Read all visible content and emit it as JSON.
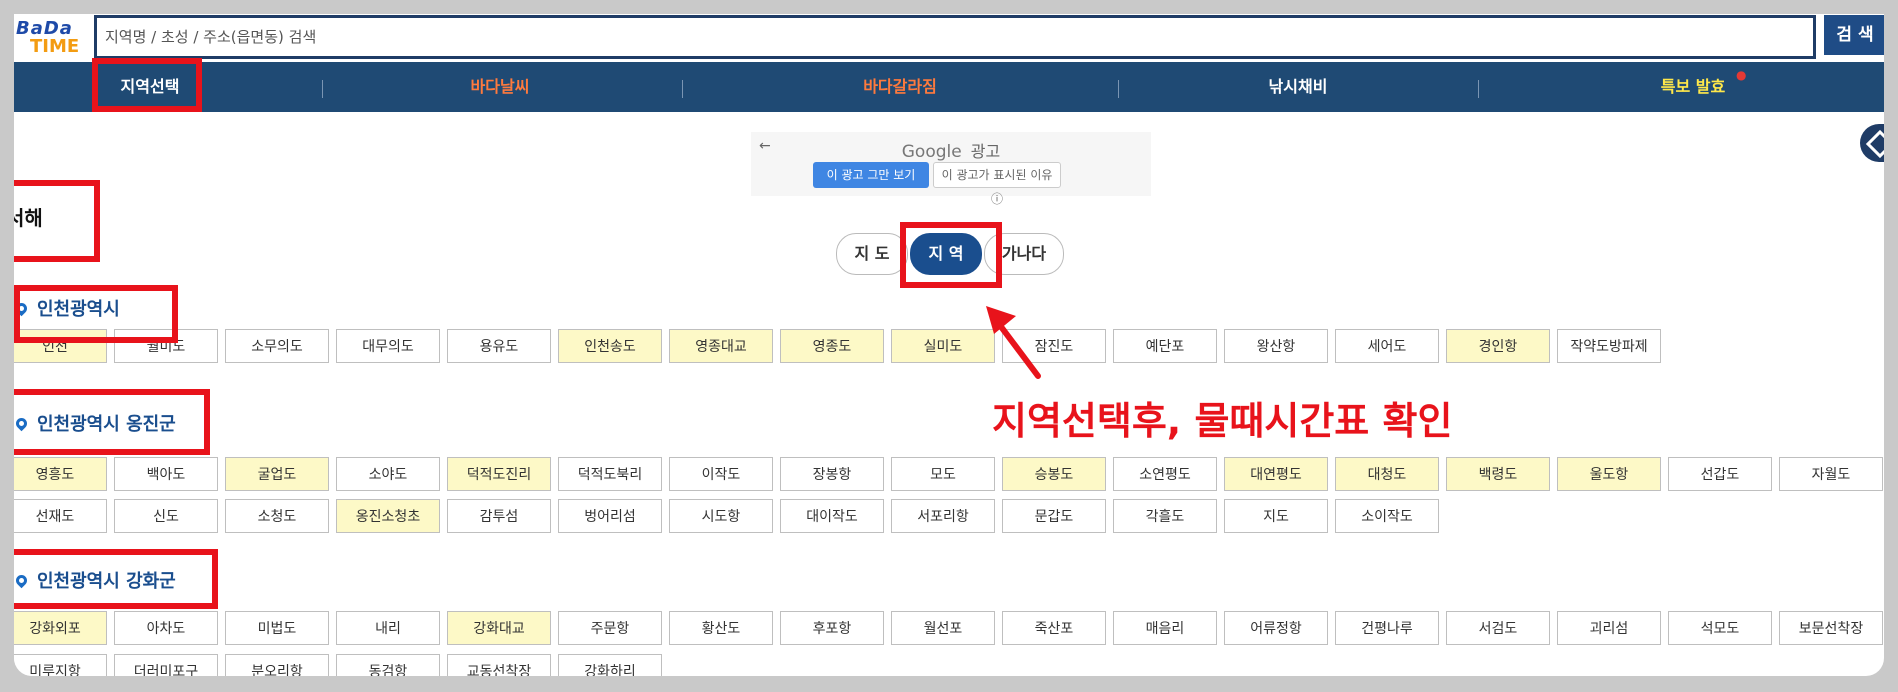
{
  "logo": {
    "line1": "BaDa",
    "line2": "TIME"
  },
  "search": {
    "placeholder": "지역명 / 초성 / 주소(읍면동) 검색",
    "button_label": "검 색"
  },
  "nav": {
    "items": [
      {
        "label": "지역선택",
        "color": "#ffffff"
      },
      {
        "label": "바다날씨",
        "color": "#ff7a3d"
      },
      {
        "label": "바다갈라짐",
        "color": "#ff7a3d"
      },
      {
        "label": "낚시채비",
        "color": "#ffffff"
      },
      {
        "label": "특보 발효",
        "color": "#ffe84a"
      }
    ]
  },
  "ad": {
    "brand": "Google",
    "label": "광고",
    "stop_button": "이 광고 그만 보기",
    "why_button": "이 광고가 표시된 이유 ⓘ"
  },
  "region_title": "서해",
  "view_tabs": {
    "map": "지 도",
    "region": "지 역",
    "gana": "가나다"
  },
  "annotation_text": "지역선택후, 물때시간표 확인",
  "sections": [
    {
      "title": "인천광역시",
      "rows": [
        [
          {
            "label": "인천",
            "highlight": true
          },
          {
            "label": "월미도",
            "highlight": false
          },
          {
            "label": "소무의도",
            "highlight": false
          },
          {
            "label": "대무의도",
            "highlight": false
          },
          {
            "label": "용유도",
            "highlight": false
          },
          {
            "label": "인천송도",
            "highlight": true
          },
          {
            "label": "영종대교",
            "highlight": true
          },
          {
            "label": "영종도",
            "highlight": true
          },
          {
            "label": "실미도",
            "highlight": true
          },
          {
            "label": "잠진도",
            "highlight": false
          },
          {
            "label": "예단포",
            "highlight": false
          },
          {
            "label": "왕산항",
            "highlight": false
          },
          {
            "label": "세어도",
            "highlight": false
          },
          {
            "label": "경인항",
            "highlight": true
          },
          {
            "label": "작약도방파제",
            "highlight": false
          }
        ]
      ]
    },
    {
      "title": "인천광역시 옹진군",
      "rows": [
        [
          {
            "label": "영흥도",
            "highlight": true
          },
          {
            "label": "백아도",
            "highlight": false
          },
          {
            "label": "굴업도",
            "highlight": true
          },
          {
            "label": "소야도",
            "highlight": false
          },
          {
            "label": "덕적도진리",
            "highlight": true
          },
          {
            "label": "덕적도북리",
            "highlight": false
          },
          {
            "label": "이작도",
            "highlight": false
          },
          {
            "label": "장봉항",
            "highlight": false
          },
          {
            "label": "모도",
            "highlight": false
          },
          {
            "label": "승봉도",
            "highlight": true
          },
          {
            "label": "소연평도",
            "highlight": false
          },
          {
            "label": "대연평도",
            "highlight": true
          },
          {
            "label": "대청도",
            "highlight": true
          },
          {
            "label": "백령도",
            "highlight": true
          },
          {
            "label": "울도항",
            "highlight": true
          },
          {
            "label": "선갑도",
            "highlight": false
          },
          {
            "label": "자월도",
            "highlight": false
          }
        ],
        [
          {
            "label": "선재도",
            "highlight": false
          },
          {
            "label": "신도",
            "highlight": false
          },
          {
            "label": "소청도",
            "highlight": false
          },
          {
            "label": "옹진소청초",
            "highlight": true
          },
          {
            "label": "감투섬",
            "highlight": false
          },
          {
            "label": "벙어리섬",
            "highlight": false
          },
          {
            "label": "시도항",
            "highlight": false
          },
          {
            "label": "대이작도",
            "highlight": false
          },
          {
            "label": "서포리항",
            "highlight": false
          },
          {
            "label": "문갑도",
            "highlight": false
          },
          {
            "label": "각흘도",
            "highlight": false
          },
          {
            "label": "지도",
            "highlight": false
          },
          {
            "label": "소이작도",
            "highlight": false
          }
        ]
      ]
    },
    {
      "title": "인천광역시 강화군",
      "rows": [
        [
          {
            "label": "강화외포",
            "highlight": true
          },
          {
            "label": "아차도",
            "highlight": false
          },
          {
            "label": "미법도",
            "highlight": false
          },
          {
            "label": "내리",
            "highlight": false
          },
          {
            "label": "강화대교",
            "highlight": true
          },
          {
            "label": "주문항",
            "highlight": false
          },
          {
            "label": "황산도",
            "highlight": false
          },
          {
            "label": "후포항",
            "highlight": false
          },
          {
            "label": "월선포",
            "highlight": false
          },
          {
            "label": "죽산포",
            "highlight": false
          },
          {
            "label": "매음리",
            "highlight": false
          },
          {
            "label": "어류정항",
            "highlight": false
          },
          {
            "label": "건평나루",
            "highlight": false
          },
          {
            "label": "서검도",
            "highlight": false
          },
          {
            "label": "괴리섬",
            "highlight": false
          },
          {
            "label": "석모도",
            "highlight": false
          },
          {
            "label": "보문선착장",
            "highlight": false
          }
        ],
        [
          {
            "label": "미루지항",
            "highlight": false
          },
          {
            "label": "더러미포구",
            "highlight": false
          },
          {
            "label": "분오리항",
            "highlight": false
          },
          {
            "label": "동검항",
            "highlight": false
          },
          {
            "label": "교동선착장",
            "highlight": false
          },
          {
            "label": "강화하리",
            "highlight": false
          }
        ]
      ]
    }
  ]
}
